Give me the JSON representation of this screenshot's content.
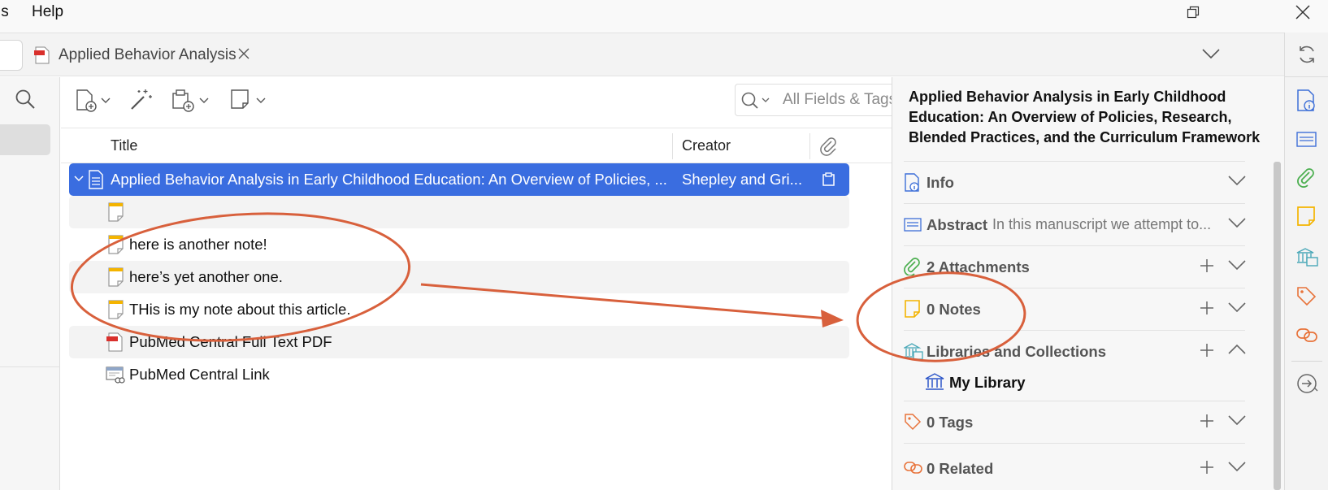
{
  "menubar": {
    "items": [
      "ls",
      "Help"
    ]
  },
  "tabs": {
    "document_tab_title": "Applied Behavior Analysis"
  },
  "toolbar": {
    "search_placeholder": "All Fields & Tags"
  },
  "columns": {
    "title": "Title",
    "creator": "Creator"
  },
  "items": {
    "parent": {
      "title": "Applied Behavior Analysis in Early Childhood Education: An Overview of Policies, ...",
      "creator": "Shepley and Gri..."
    },
    "children": [
      {
        "title": "",
        "type": "note"
      },
      {
        "title": "here is another note!",
        "type": "note"
      },
      {
        "title": "here’s yet another one.",
        "type": "note"
      },
      {
        "title": "THis is my note about this article.",
        "type": "note"
      },
      {
        "title": "PubMed Central Full Text PDF",
        "type": "pdf"
      },
      {
        "title": "PubMed Central Link",
        "type": "link"
      }
    ]
  },
  "item_pane": {
    "title": "Applied Behavior Analysis in Early Childhood Education: An Overview of Policies, Research, Blended Practices, and the Curriculum Framework",
    "sections": {
      "info": "Info",
      "abstract_label": "Abstract",
      "abstract_preview": "In this manuscript we attempt to...",
      "attachments": "2 Attachments",
      "notes": "0 Notes",
      "libraries": "Libraries and Collections",
      "library_name": "My Library",
      "tags": "0 Tags",
      "related": "0 Related"
    }
  },
  "colors": {
    "selection": "#3a6de0",
    "annotation": "#d8603c",
    "note_yellow": "#f4b400",
    "attachment_green": "#4caf50",
    "tag_orange": "#e8733a",
    "info_blue": "#3d6fd8"
  },
  "icons": [
    "search-icon",
    "new-item-icon",
    "magic-wand-icon",
    "add-attachment-icon",
    "new-note-icon",
    "paperclip-icon",
    "sync-icon",
    "chevron-down-icon",
    "close-icon",
    "restore-icon",
    "info-icon",
    "abstract-icon",
    "attachment-icon",
    "note-icon",
    "library-icon",
    "tag-icon",
    "related-icon",
    "locate-icon"
  ]
}
